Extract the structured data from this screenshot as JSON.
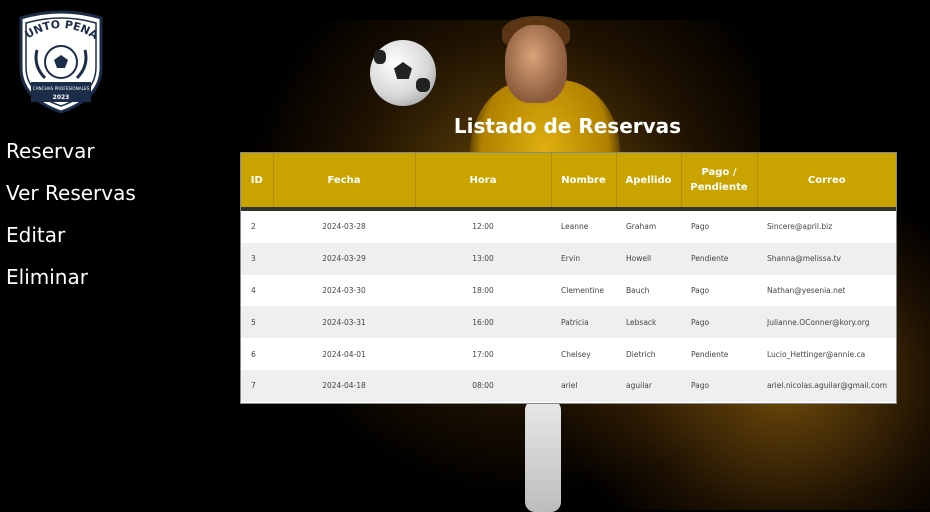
{
  "logo": {
    "top_text": "PUNTO PENAL",
    "sub_text": "CANCHAS PROFESIONALES",
    "year": "2023"
  },
  "nav": {
    "items": [
      {
        "label": "Reservar"
      },
      {
        "label": "Ver Reservas"
      },
      {
        "label": "Editar"
      },
      {
        "label": "Eliminar"
      }
    ]
  },
  "page": {
    "title": "Listado de Reservas"
  },
  "table": {
    "headers": [
      "ID",
      "Fecha",
      "Hora",
      "Nombre",
      "Apellido",
      "Pago / Pendiente",
      "Correo"
    ],
    "rows": [
      [
        "2",
        "2024-03-28",
        "12:00",
        "Leanne",
        "Graham",
        "Pago",
        "Sincere@april.biz"
      ],
      [
        "3",
        "2024-03-29",
        "13:00",
        "Ervin",
        "Howell",
        "Pendiente",
        "Shanna@melissa.tv"
      ],
      [
        "4",
        "2024-03-30",
        "18:00",
        "Clementine",
        "Bauch",
        "Pago",
        "Nathan@yesenia.net"
      ],
      [
        "5",
        "2024-03-31",
        "16:00",
        "Patricia",
        "Lebsack",
        "Pago",
        "Julianne.OConner@kory.org"
      ],
      [
        "6",
        "2024-04-01",
        "17:00",
        "Chelsey",
        "Dietrich",
        "Pendiente",
        "Lucio_Hettinger@annie.ca"
      ],
      [
        "7",
        "2024-04-18",
        "08:00",
        "ariel",
        "aguilar",
        "Pago",
        "ariel.nicolas.aguilar@gmail.com"
      ]
    ]
  },
  "colors": {
    "accent": "#c9a400",
    "background": "#000000",
    "row_alt": "#efefef"
  }
}
